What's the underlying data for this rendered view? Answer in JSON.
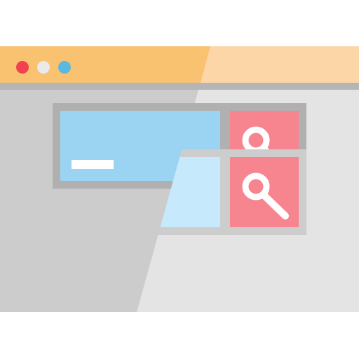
{
  "colors": {
    "titlebar": "#F8C271",
    "titlebar_light": "#FCD6A7",
    "titlebar_border": "#B5B5B5",
    "content_dark": "#CCCCCC",
    "content_light": "#E4E4E4",
    "search_frame": "#B0B0B0",
    "search_input": "#9BD4F3",
    "search_input_light": "#C6E9FC",
    "search_button": "#F7858F",
    "cursor_bar": "#FFFFFF",
    "search_icon": "#FFFFFF",
    "dot_close": "#F2424F",
    "dot_minimize": "#EAEAEA",
    "dot_maximize": "#5BB8E1"
  },
  "window_controls": [
    "close-dot",
    "minimize-dot",
    "maximize-dot"
  ],
  "search": {
    "input_value": "",
    "button_icon": "magnifier-icon"
  }
}
